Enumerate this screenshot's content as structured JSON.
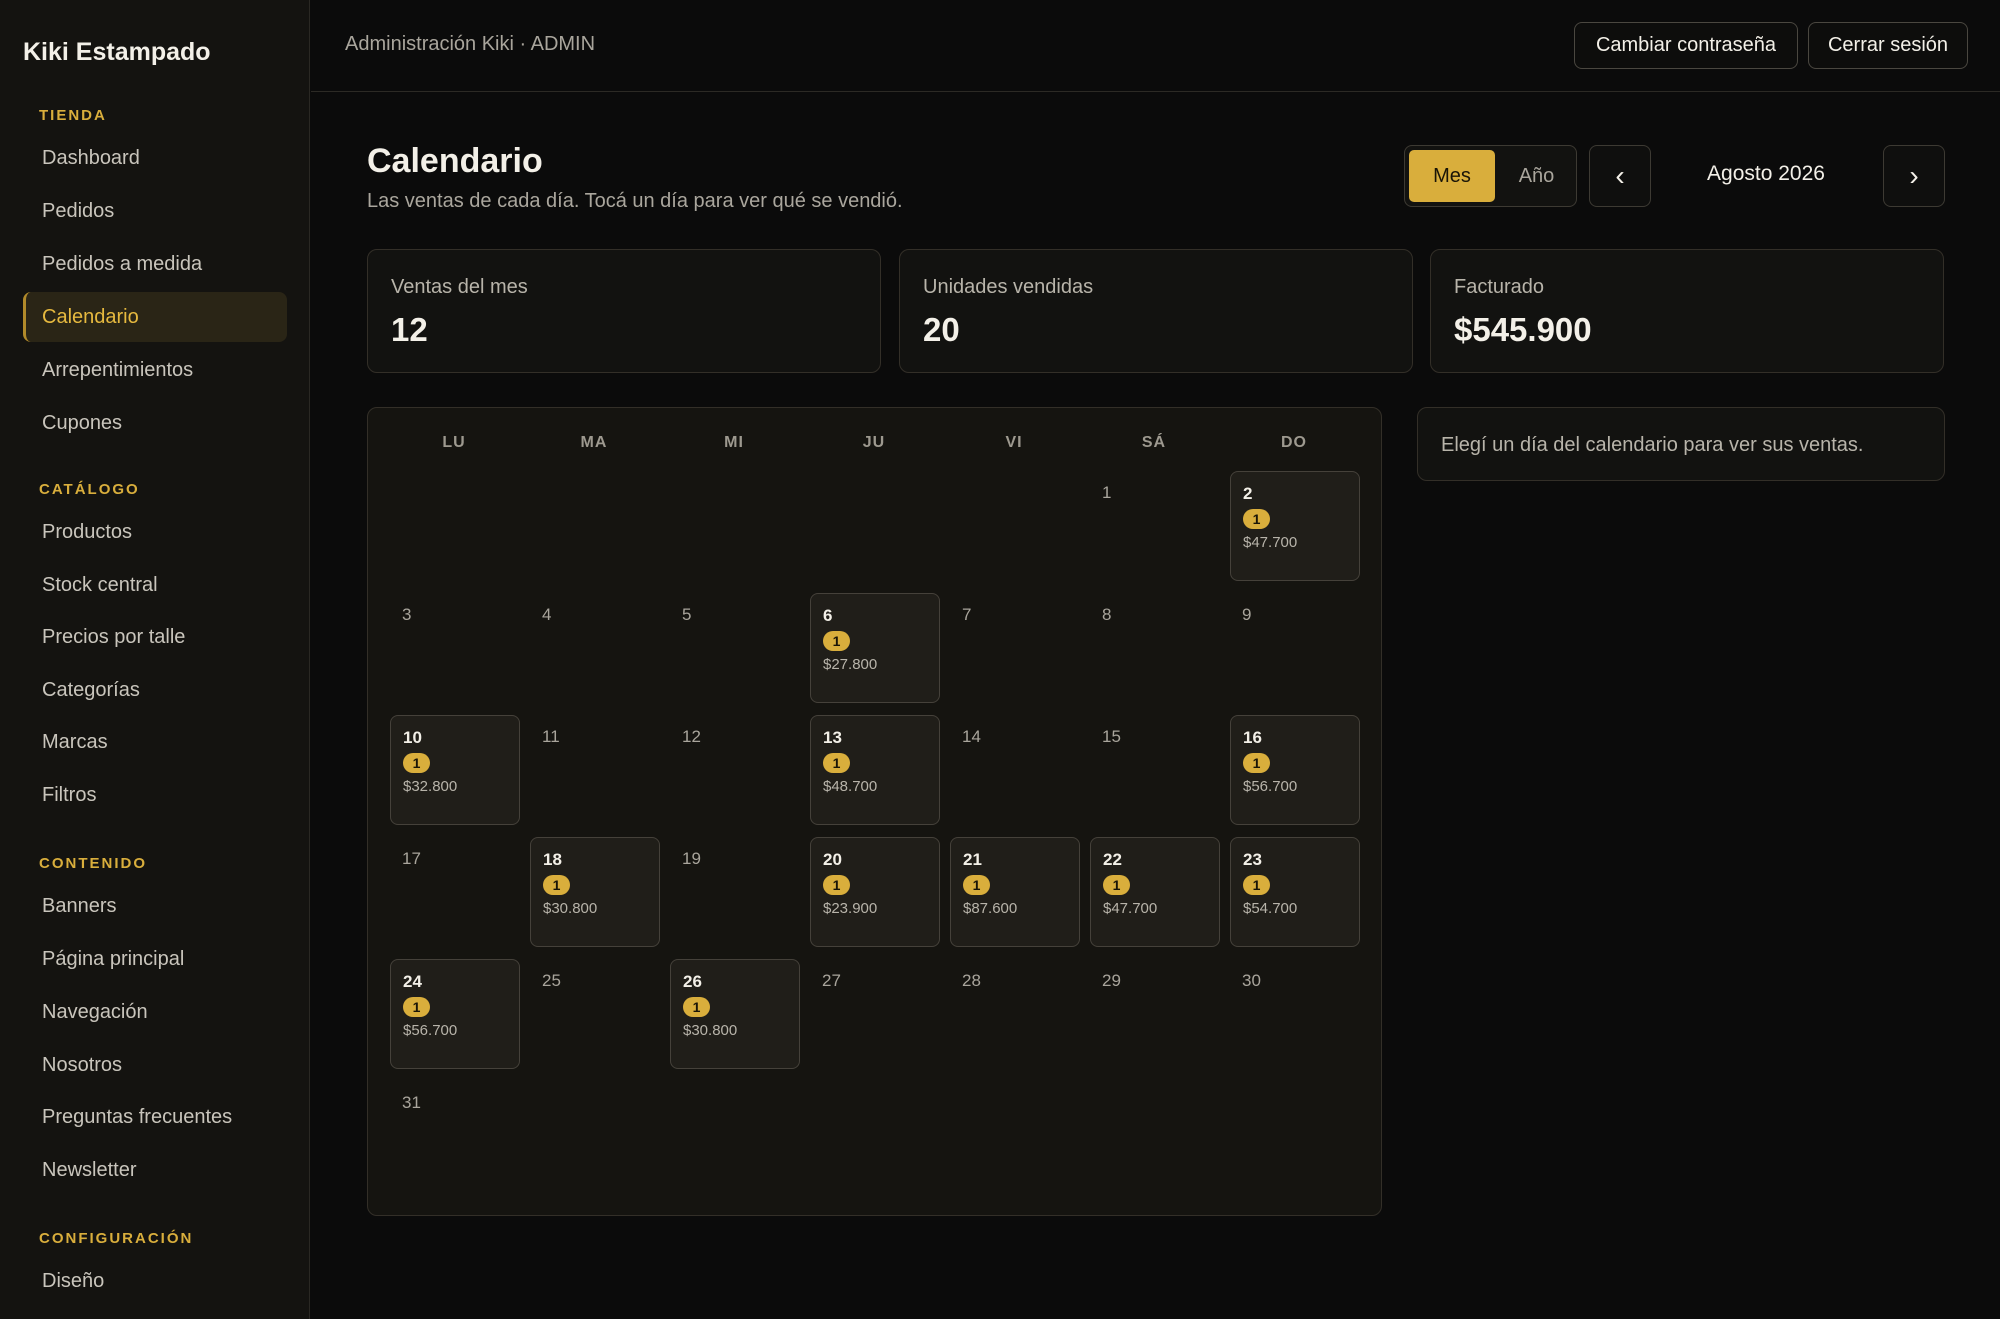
{
  "sidebar": {
    "brand": "Kiki Estampado",
    "sections": [
      {
        "title": "TIENDA",
        "items": [
          "Dashboard",
          "Pedidos",
          "Pedidos a medida",
          "Calendario",
          "Arrepentimientos",
          "Cupones"
        ]
      },
      {
        "title": "CATÁLOGO",
        "items": [
          "Productos",
          "Stock central",
          "Precios por talle",
          "Categorías",
          "Marcas",
          "Filtros"
        ]
      },
      {
        "title": "CONTENIDO",
        "items": [
          "Banners",
          "Página principal",
          "Navegación",
          "Nosotros",
          "Preguntas frecuentes",
          "Newsletter"
        ]
      },
      {
        "title": "CONFIGURACIÓN",
        "items": [
          "Diseño"
        ]
      }
    ],
    "active_item": "Calendario"
  },
  "topbar": {
    "title": "Administración Kiki · ADMIN",
    "change_password": "Cambiar contraseña",
    "logout": "Cerrar sesión"
  },
  "header": {
    "title": "Calendario",
    "subtitle": "Las ventas de cada día. Tocá un día para ver qué se vendió.",
    "view_month": "Mes",
    "view_year": "Año",
    "prev_icon": "‹",
    "next_icon": "›",
    "period": "Agosto 2026"
  },
  "stats": [
    {
      "label": "Ventas del mes",
      "value": "12"
    },
    {
      "label": "Unidades vendidas",
      "value": "20"
    },
    {
      "label": "Facturado",
      "value": "$545.900"
    }
  ],
  "calendar": {
    "weekdays": [
      "LU",
      "MA",
      "MI",
      "JU",
      "VI",
      "SÁ",
      "DO"
    ],
    "first_weekday_index": 5,
    "days_in_month": 31,
    "sales": {
      "2": {
        "count": "1",
        "amount": "$47.700"
      },
      "6": {
        "count": "1",
        "amount": "$27.800"
      },
      "10": {
        "count": "1",
        "amount": "$32.800"
      },
      "13": {
        "count": "1",
        "amount": "$48.700"
      },
      "16": {
        "count": "1",
        "amount": "$56.700"
      },
      "18": {
        "count": "1",
        "amount": "$30.800"
      },
      "20": {
        "count": "1",
        "amount": "$23.900"
      },
      "21": {
        "count": "1",
        "amount": "$87.600"
      },
      "22": {
        "count": "1",
        "amount": "$47.700"
      },
      "23": {
        "count": "1",
        "amount": "$54.700"
      },
      "24": {
        "count": "1",
        "amount": "$56.700"
      },
      "26": {
        "count": "1",
        "amount": "$30.800"
      }
    }
  },
  "detail": {
    "empty_text": "Elegí un día del calendario para ver sus ventas."
  },
  "colors": {
    "accent": "#d9ae3c",
    "background": "#0b0b0b",
    "panel": "#121210"
  }
}
